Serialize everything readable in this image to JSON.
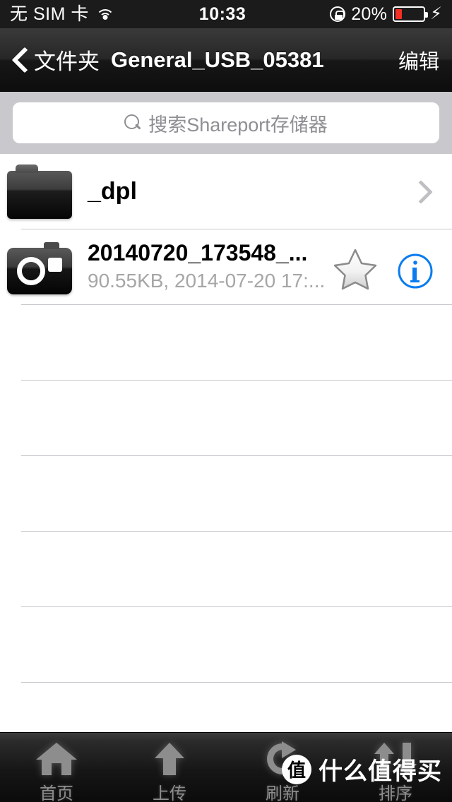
{
  "status_bar": {
    "carrier": "无 SIM 卡",
    "wifi_icon": "wifi-icon",
    "time": "10:33",
    "lock_icon": "rotation-lock-icon",
    "battery_percent": "20%",
    "battery_level": 20,
    "charging_icon": "⚡",
    "battery_color": "#f42f24"
  },
  "nav_bar": {
    "back_label": "文件夹",
    "back_icon": "chevron-left-icon",
    "title": "General_USB_05381",
    "edit_label": "编辑"
  },
  "search": {
    "placeholder": "搜索Shareport存储器",
    "value": "",
    "icon": "search-icon"
  },
  "list": {
    "rows": [
      {
        "icon": "folder-icon",
        "title": "_dpl",
        "subtitle": "",
        "accessory": "chevron-right-icon"
      },
      {
        "icon": "camera-icon",
        "title": "20140720_173548_...",
        "subtitle": "90.55KB, 2014-07-20 17:...",
        "accessory": "info-icon",
        "star": "star-icon"
      }
    ],
    "empty_rows": 5,
    "separator_color": "#c8c7cc"
  },
  "toolbar": {
    "items": [
      {
        "icon": "home-icon",
        "label": "首页"
      },
      {
        "icon": "upload-icon",
        "label": "上传"
      },
      {
        "icon": "refresh-icon",
        "label": "刷新"
      },
      {
        "icon": "sort-icon",
        "label": "排序"
      }
    ]
  },
  "watermark": {
    "badge": "值",
    "text": "什么值得买"
  },
  "colors": {
    "accent_blue": "#0a7cf0",
    "chrome_dark": "#1b1b1b",
    "search_bg": "#c9c8cd",
    "secondary_text": "#a6a6a6"
  }
}
